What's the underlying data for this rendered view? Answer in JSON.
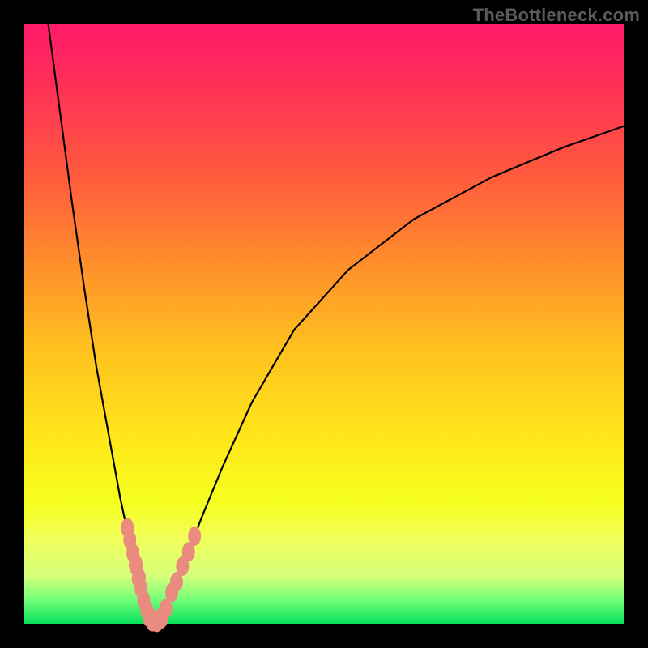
{
  "watermark": "TheBottleneck.com",
  "chart_data": {
    "type": "line",
    "title": "",
    "xlabel": "",
    "ylabel": "",
    "xlim": [
      0,
      100
    ],
    "ylim": [
      0,
      100
    ],
    "grid": false,
    "legend": false,
    "series": [
      {
        "name": "left-branch",
        "x": [
          4,
          6,
          8,
          10,
          12,
          14,
          16,
          17.5,
          18.5,
          19.2,
          19.8,
          20.3,
          20.8,
          21.2
        ],
        "y": [
          100,
          85,
          70,
          56,
          43,
          32,
          21,
          14,
          10,
          7,
          5,
          3.2,
          1.6,
          0.4
        ]
      },
      {
        "name": "right-branch",
        "x": [
          22.5,
          23.2,
          24.2,
          25.6,
          27.2,
          29.5,
          33,
          38,
          45,
          54,
          65,
          78,
          90,
          100
        ],
        "y": [
          0.4,
          1.6,
          3.8,
          7,
          11.5,
          17.5,
          26,
          37,
          49,
          59,
          67.5,
          74.5,
          79.5,
          83
        ]
      }
    ],
    "scatter_markers": {
      "name": "highlighted-points",
      "points": [
        {
          "x": 17.2,
          "y": 16.0,
          "r": 1.2
        },
        {
          "x": 17.6,
          "y": 14.0,
          "r": 1.2
        },
        {
          "x": 18.1,
          "y": 11.8,
          "r": 1.2
        },
        {
          "x": 18.6,
          "y": 9.8,
          "r": 1.3
        },
        {
          "x": 19.1,
          "y": 7.6,
          "r": 1.3
        },
        {
          "x": 19.5,
          "y": 5.8,
          "r": 1.2
        },
        {
          "x": 19.9,
          "y": 4.0,
          "r": 1.2
        },
        {
          "x": 20.4,
          "y": 2.4,
          "r": 1.2
        },
        {
          "x": 20.9,
          "y": 1.1,
          "r": 1.3
        },
        {
          "x": 21.4,
          "y": 0.45,
          "r": 1.3
        },
        {
          "x": 22.1,
          "y": 0.35,
          "r": 1.3
        },
        {
          "x": 22.8,
          "y": 0.9,
          "r": 1.3
        },
        {
          "x": 23.6,
          "y": 2.5,
          "r": 1.2
        },
        {
          "x": 24.6,
          "y": 5.2,
          "r": 1.2
        },
        {
          "x": 25.4,
          "y": 7.0,
          "r": 1.2
        },
        {
          "x": 26.4,
          "y": 9.6,
          "r": 1.2
        },
        {
          "x": 27.4,
          "y": 12.0,
          "r": 1.2
        },
        {
          "x": 28.4,
          "y": 14.6,
          "r": 1.2
        }
      ]
    },
    "gradient_stops": [
      {
        "pos": 0,
        "color": "#ff1a6a"
      },
      {
        "pos": 10,
        "color": "#ff2f57"
      },
      {
        "pos": 25,
        "color": "#ff5a3e"
      },
      {
        "pos": 40,
        "color": "#ff8f2b"
      },
      {
        "pos": 55,
        "color": "#ffc31e"
      },
      {
        "pos": 70,
        "color": "#ffe91a"
      },
      {
        "pos": 80,
        "color": "#f6ff20"
      },
      {
        "pos": 86,
        "color": "#f0ff5c"
      },
      {
        "pos": 92,
        "color": "#d6ff7a"
      },
      {
        "pos": 96,
        "color": "#73ff79"
      },
      {
        "pos": 100,
        "color": "#08e05a"
      }
    ]
  }
}
